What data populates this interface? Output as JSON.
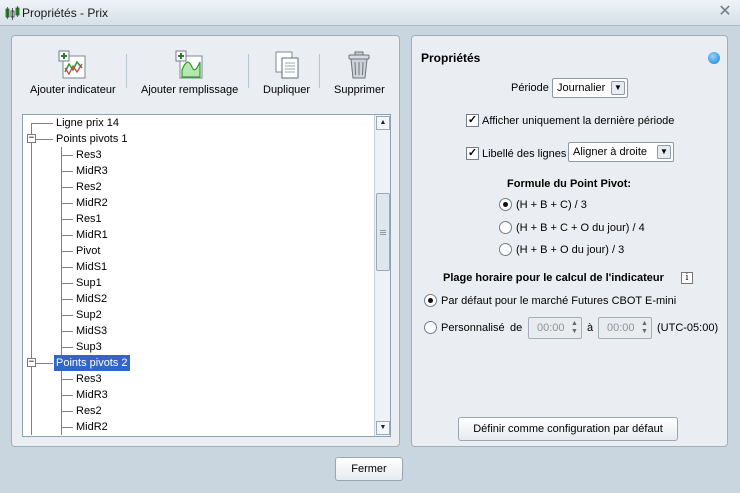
{
  "window": {
    "title": "Propriétés - Prix",
    "close_glyph": "✕"
  },
  "toolbar": {
    "add_indicator": "Ajouter indicateur",
    "add_fill": "Ajouter remplissage",
    "duplicate": "Dupliquer",
    "delete": "Supprimer"
  },
  "tree": {
    "rows": [
      {
        "label": "Ligne prix 14",
        "level": 0
      },
      {
        "label": "Points pivots 1",
        "level": 0,
        "expander": "−"
      },
      {
        "label": "Res3",
        "level": 1
      },
      {
        "label": "MidR3",
        "level": 1
      },
      {
        "label": "Res2",
        "level": 1
      },
      {
        "label": "MidR2",
        "level": 1
      },
      {
        "label": "Res1",
        "level": 1
      },
      {
        "label": "MidR1",
        "level": 1
      },
      {
        "label": "Pivot",
        "level": 1
      },
      {
        "label": "MidS1",
        "level": 1
      },
      {
        "label": "Sup1",
        "level": 1
      },
      {
        "label": "MidS2",
        "level": 1
      },
      {
        "label": "Sup2",
        "level": 1
      },
      {
        "label": "MidS3",
        "level": 1
      },
      {
        "label": "Sup3",
        "level": 1
      },
      {
        "label": "Points pivots 2",
        "level": 0,
        "expander": "−",
        "selected": true
      },
      {
        "label": "Res3",
        "level": 1
      },
      {
        "label": "MidR3",
        "level": 1
      },
      {
        "label": "Res2",
        "level": 1
      },
      {
        "label": "MidR2",
        "level": 1
      }
    ],
    "scroll_up_glyph": "▲",
    "scroll_down_glyph": "▼"
  },
  "properties": {
    "title": "Propriétés",
    "period_label": "Période",
    "period_value": "Journalier",
    "show_last_period": {
      "label": "Afficher uniquement la dernière période",
      "checked": true
    },
    "line_labels": {
      "label": "Libellé des lignes",
      "checked": true,
      "value": "Aligner à droite"
    },
    "formula_heading": "Formule du Point Pivot:",
    "formulas": [
      {
        "label": "(H + B + C) / 3",
        "selected": true
      },
      {
        "label": "(H + B + C + O du jour) / 4",
        "selected": false
      },
      {
        "label": "(H + B + O du jour) / 3",
        "selected": false
      }
    ],
    "time_range_heading": "Plage horaire pour le calcul de l'indicateur",
    "info_glyph": "i",
    "default_market": {
      "label": "Par défaut pour le marché Futures CBOT E-mini",
      "selected": true
    },
    "custom": {
      "label": "Personnalisé",
      "from_label": "de",
      "from_value": "00:00",
      "to_label": "à",
      "to_value": "00:00",
      "timezone": "(UTC-05:00)",
      "selected": false
    },
    "set_default_button": "Définir comme configuration par défaut"
  },
  "footer": {
    "close_button": "Fermer"
  },
  "colors": {
    "selection": "#2f66c8",
    "window_bg": "#c9d6e0",
    "panel_bg": "#eaeef2"
  }
}
